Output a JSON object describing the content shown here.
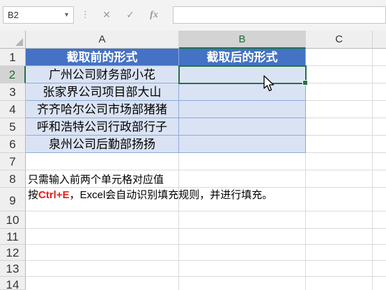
{
  "formula_bar": {
    "name_box": "B2",
    "icons": [
      "cancel-icon",
      "enter-icon",
      "function-icon"
    ],
    "fx_label": "fx",
    "formula": ""
  },
  "columns": [
    "A",
    "B",
    "C"
  ],
  "rows": [
    "1",
    "2",
    "3",
    "4",
    "5",
    "6",
    "7",
    "8",
    "9",
    "10",
    "11",
    "12",
    "13",
    "14"
  ],
  "selected_cell": "B2",
  "table": {
    "header_a": "截取前的形式",
    "header_b": "截取后的形式",
    "rows": [
      {
        "a": "广州公司财务部小花",
        "b": ""
      },
      {
        "a": "张家界公司项目部大山",
        "b": ""
      },
      {
        "a": "齐齐哈尔公司市场部猪猪",
        "b": ""
      },
      {
        "a": "呼和浩特公司行政部行子",
        "b": ""
      },
      {
        "a": "泉州公司后勤部扬扬",
        "b": ""
      }
    ]
  },
  "notes": {
    "line1": "只需输入前两个单元格对应值",
    "line2_prefix": "按",
    "line2_shortcut": "Ctrl+E",
    "line2_suffix": "，Excel会自动识别填充规则，并进行填充。"
  },
  "colors": {
    "header_fill": "#4472c4",
    "data_fill": "#dae3f3",
    "selection": "#217346",
    "shortcut_text": "#e0201a"
  }
}
